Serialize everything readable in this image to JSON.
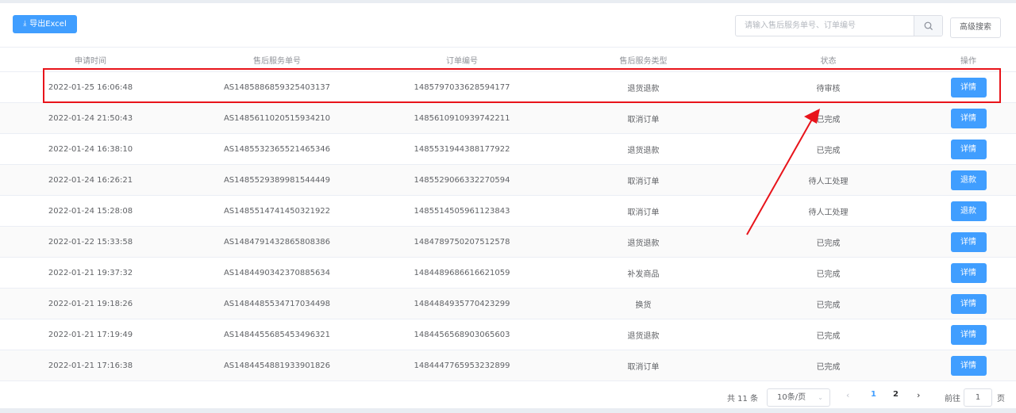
{
  "toolbar": {
    "export_label": "导出Excel",
    "search_placeholder": "请输入售后服务单号、订单编号",
    "advanced_search_label": "高级搜索"
  },
  "table": {
    "headers": [
      "申请时间",
      "售后服务单号",
      "订单编号",
      "售后服务类型",
      "状态",
      "操作"
    ],
    "rows": [
      {
        "time": "2022-01-25 16:06:48",
        "service_no": "AS1485886859325403137",
        "order_no": "1485797033628594177",
        "type": "退货退款",
        "status": "待审核",
        "action": "详情"
      },
      {
        "time": "2022-01-24 21:50:43",
        "service_no": "AS1485611020515934210",
        "order_no": "1485610910939742211",
        "type": "取消订单",
        "status": "已完成",
        "action": "详情"
      },
      {
        "time": "2022-01-24 16:38:10",
        "service_no": "AS1485532365521465346",
        "order_no": "1485531944388177922",
        "type": "退货退款",
        "status": "已完成",
        "action": "详情"
      },
      {
        "time": "2022-01-24 16:26:21",
        "service_no": "AS1485529389981544449",
        "order_no": "1485529066332270594",
        "type": "取消订单",
        "status": "待人工处理",
        "action": "退款"
      },
      {
        "time": "2022-01-24 15:28:08",
        "service_no": "AS1485514741450321922",
        "order_no": "1485514505961123843",
        "type": "取消订单",
        "status": "待人工处理",
        "action": "退款"
      },
      {
        "time": "2022-01-22 15:33:58",
        "service_no": "AS1484791432865808386",
        "order_no": "1484789750207512578",
        "type": "退货退款",
        "status": "已完成",
        "action": "详情"
      },
      {
        "time": "2022-01-21 19:37:32",
        "service_no": "AS1484490342370885634",
        "order_no": "1484489686616621059",
        "type": "补发商品",
        "status": "已完成",
        "action": "详情"
      },
      {
        "time": "2022-01-21 19:18:26",
        "service_no": "AS1484485534717034498",
        "order_no": "1484484935770423299",
        "type": "换货",
        "status": "已完成",
        "action": "详情"
      },
      {
        "time": "2022-01-21 17:19:49",
        "service_no": "AS1484455685453496321",
        "order_no": "1484456568903065603",
        "type": "退货退款",
        "status": "已完成",
        "action": "详情"
      },
      {
        "time": "2022-01-21 17:16:38",
        "service_no": "AS1484454881933901826",
        "order_no": "1484447765953232899",
        "type": "取消订单",
        "status": "已完成",
        "action": "详情"
      }
    ]
  },
  "pagination": {
    "total_label": "共 11 条",
    "page_size_label": "10条/页",
    "pages": [
      "1",
      "2"
    ],
    "current_page": "1",
    "goto_label": "前往",
    "goto_value": "1",
    "goto_unit": "页"
  },
  "annotation": {
    "highlight_color": "#e8141b"
  },
  "colors": {
    "primary": "#409eff"
  }
}
